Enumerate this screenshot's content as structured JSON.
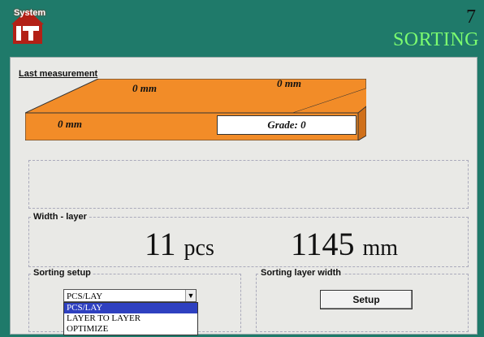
{
  "header": {
    "logo_text": "System",
    "screen_number": "7",
    "screen_title": "SORTING"
  },
  "last_measurement": {
    "label": "Last measurement",
    "top_left_value": "0 mm",
    "top_right_value": "0 mm",
    "front_value": "0 mm",
    "grade_label": "Grade:",
    "grade_value": "0"
  },
  "width_layer": {
    "label": "Width - layer",
    "pcs_value": "11",
    "pcs_unit": "pcs",
    "mm_value": "1145",
    "mm_unit": "mm"
  },
  "sorting_setup": {
    "label": "Sorting setup",
    "selected": "PCS/LAY",
    "options": [
      "PCS/LAY",
      "LAYER TO LAYER",
      "OPTIMIZE"
    ]
  },
  "sorting_layer_width": {
    "label": "Sorting layer width",
    "button_label": "Setup"
  },
  "colors": {
    "header_bg": "#1f7a6a",
    "title_green": "#7cfc70",
    "slab_orange": "#f28c28",
    "logo_red": "#b32016"
  }
}
